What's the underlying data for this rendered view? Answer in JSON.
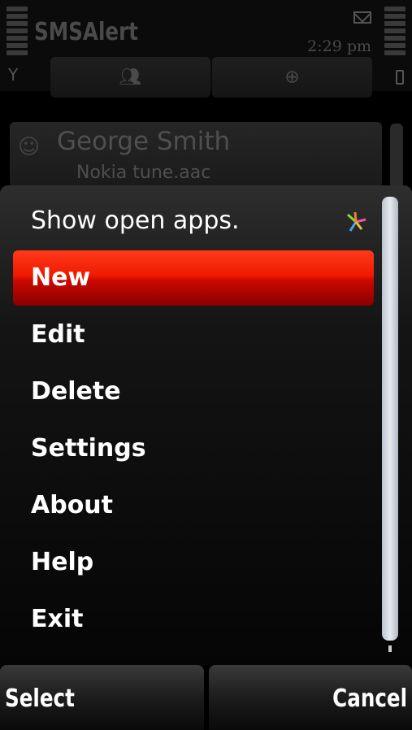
{
  "statusbar": {
    "app_title": "SMSAlert",
    "clock": "2:29 pm"
  },
  "background_app": {
    "tabs": [
      {
        "icon": "contacts-icon"
      },
      {
        "icon": "globe-icon"
      }
    ],
    "contact": {
      "name": "George Smith",
      "subtitle": "Nokia tune.aac"
    }
  },
  "menu": {
    "items": [
      {
        "label": "Show open apps."
      },
      {
        "label": "New"
      },
      {
        "label": "Edit"
      },
      {
        "label": "Delete"
      },
      {
        "label": "Settings"
      },
      {
        "label": "About"
      },
      {
        "label": "Help"
      },
      {
        "label": "Exit"
      }
    ],
    "selected_index": 1,
    "highlight_color": "#e81400"
  },
  "softkeys": {
    "left": "Select",
    "right": "Cancel"
  }
}
